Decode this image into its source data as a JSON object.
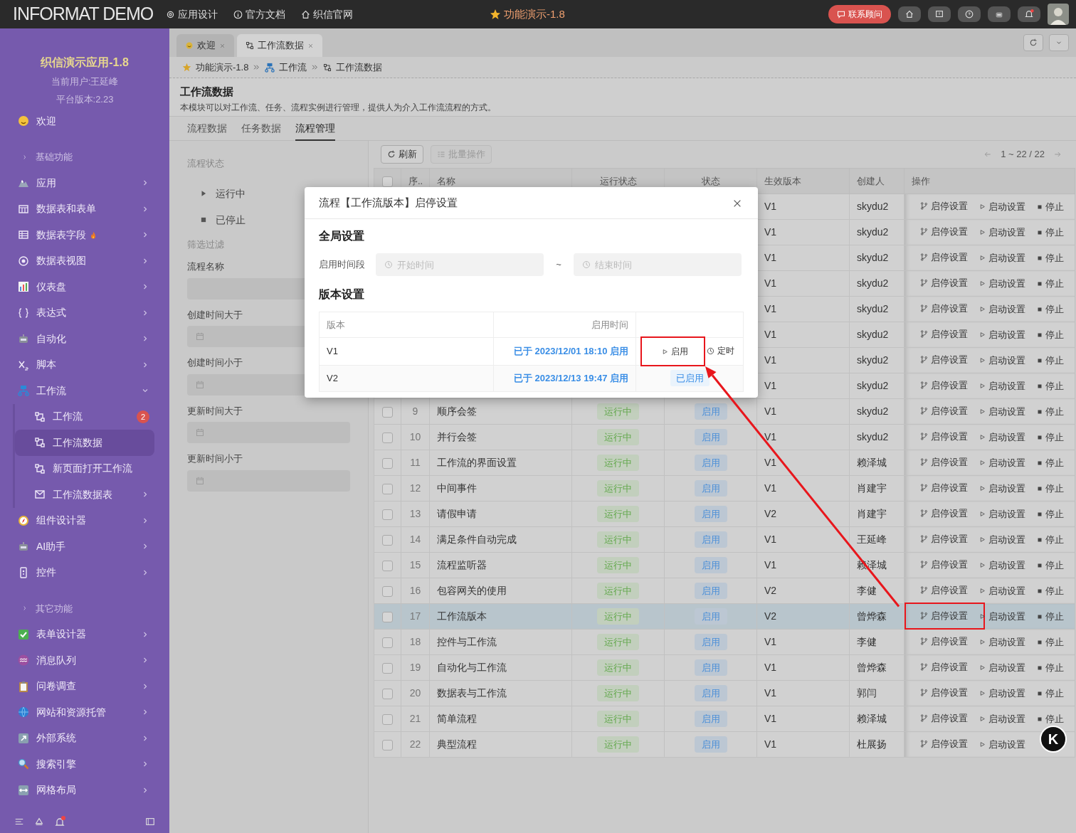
{
  "topbar": {
    "logo": "INFORMAT DEMO",
    "nav": [
      "应用设计",
      "官方文档",
      "织信官网"
    ],
    "title": "功能演示-1.8",
    "contact_button": "联系顾问"
  },
  "sidebar": {
    "app_name": "织信演示应用-1.8",
    "user": "当前用户:王延峰",
    "version": "平台版本:2.23",
    "items": [
      {
        "kind": "item",
        "label": "欢迎",
        "expandable": false,
        "selected": false
      },
      {
        "kind": "group",
        "label": "基础功能"
      },
      {
        "kind": "item",
        "label": "应用",
        "expandable": true,
        "expanded": false,
        "selected": false
      },
      {
        "kind": "item",
        "label": "数据表和表单",
        "expandable": true,
        "expanded": false,
        "selected": false
      },
      {
        "kind": "item",
        "label": "数据表字段",
        "expandable": true,
        "expanded": false,
        "selected": false
      },
      {
        "kind": "item",
        "label": "数据表视图",
        "expandable": true,
        "expanded": false,
        "selected": false
      },
      {
        "kind": "item",
        "label": "仪表盘",
        "expandable": true,
        "expanded": false,
        "selected": false
      },
      {
        "kind": "item",
        "label": "表达式",
        "expandable": true,
        "expanded": false,
        "selected": false
      },
      {
        "kind": "item",
        "label": "自动化",
        "expandable": true,
        "expanded": false,
        "selected": false
      },
      {
        "kind": "item",
        "label": "脚本",
        "expandable": true,
        "expanded": false,
        "selected": false
      },
      {
        "kind": "item",
        "label": "工作流",
        "expandable": true,
        "expanded": true,
        "selected": false,
        "children": [
          {
            "label": "工作流",
            "badge": "2",
            "expandable": false,
            "selected": false
          },
          {
            "label": "工作流数据",
            "expandable": false,
            "selected": true
          },
          {
            "label": "新页面打开工作流",
            "expandable": false,
            "selected": false
          },
          {
            "label": "工作流数据表",
            "expandable": true,
            "expanded": false,
            "selected": false
          }
        ]
      },
      {
        "kind": "item",
        "label": "组件设计器",
        "expandable": true,
        "expanded": false,
        "selected": false
      },
      {
        "kind": "item",
        "label": "AI助手",
        "expandable": true,
        "expanded": false,
        "selected": false
      },
      {
        "kind": "item",
        "label": "控件",
        "expandable": true,
        "expanded": false,
        "selected": false
      },
      {
        "kind": "group",
        "label": "其它功能"
      },
      {
        "kind": "item",
        "label": "表单设计器",
        "expandable": true,
        "expanded": false,
        "selected": false
      },
      {
        "kind": "item",
        "label": "消息队列",
        "expandable": true,
        "expanded": false,
        "selected": false
      },
      {
        "kind": "item",
        "label": "问卷调查",
        "expandable": true,
        "expanded": false,
        "selected": false
      },
      {
        "kind": "item",
        "label": "网站和资源托管",
        "expandable": true,
        "expanded": false,
        "selected": false
      },
      {
        "kind": "item",
        "label": "外部系统",
        "expandable": true,
        "expanded": false,
        "selected": false
      },
      {
        "kind": "item",
        "label": "搜索引擎",
        "expandable": true,
        "expanded": false,
        "selected": false
      },
      {
        "kind": "item",
        "label": "网格布局",
        "expandable": true,
        "expanded": false,
        "selected": false
      }
    ]
  },
  "tabs": [
    {
      "label": "欢迎",
      "selected": false
    },
    {
      "label": "工作流数据",
      "selected": true
    }
  ],
  "breadcrumb": [
    "功能演示-1.8",
    "工作流",
    "工作流数据"
  ],
  "page": {
    "title": "工作流数据",
    "description": "本模块可以对工作流、任务、流程实例进行管理，提供人为介入工作流流程的方式。"
  },
  "subtabs": [
    {
      "label": "流程数据",
      "selected": false
    },
    {
      "label": "任务数据",
      "selected": false
    },
    {
      "label": "流程管理",
      "selected": true
    }
  ],
  "filters": {
    "status_title": "流程状态",
    "statuses": [
      {
        "label": "运行中",
        "kind": "running"
      },
      {
        "label": "已停止",
        "kind": "stopped"
      }
    ],
    "filter_title": "筛选过滤",
    "fields": [
      {
        "label": "流程名称",
        "kind": "text"
      },
      {
        "label": "创建时间大于",
        "kind": "date"
      },
      {
        "label": "创建时间小于",
        "kind": "date"
      },
      {
        "label": "更新时间大于",
        "kind": "date"
      },
      {
        "label": "更新时间小于",
        "kind": "date"
      }
    ]
  },
  "toolbar": {
    "refresh": "刷新",
    "batch": "批量操作",
    "batch_disabled": true,
    "pagination": "1 ~ 22 / 22"
  },
  "table": {
    "all_checked": false,
    "columns": [
      "序..",
      "名称",
      "运行状态",
      "状态",
      "生效版本",
      "创建人",
      "操作"
    ],
    "rows": [
      {
        "version": "V1",
        "creator": "skydu2",
        "actions": [
          "启停设置",
          "启动设置",
          "停止"
        ],
        "selected": false,
        "highlighted": false
      },
      {
        "version": "V1",
        "creator": "skydu2",
        "actions": [
          "启停设置",
          "启动设置",
          "停止"
        ],
        "selected": false,
        "highlighted": false
      },
      {
        "version": "V1",
        "creator": "skydu2",
        "actions": [
          "启停设置",
          "启动设置",
          "停止"
        ],
        "selected": false,
        "highlighted": false
      },
      {
        "version": "V1",
        "creator": "skydu2",
        "actions": [
          "启停设置",
          "启动设置",
          "停止"
        ],
        "selected": false,
        "highlighted": false
      },
      {
        "version": "V1",
        "creator": "skydu2",
        "actions": [
          "启停设置",
          "启动设置",
          "停止"
        ],
        "selected": false,
        "highlighted": false
      },
      {
        "version": "V1",
        "creator": "skydu2",
        "actions": [
          "启停设置",
          "启动设置",
          "停止"
        ],
        "selected": false,
        "highlighted": false
      },
      {
        "version": "V1",
        "creator": "skydu2",
        "actions": [
          "启停设置",
          "启动设置",
          "停止"
        ],
        "selected": false,
        "highlighted": false
      },
      {
        "version": "V1",
        "creator": "skydu2",
        "actions": [
          "启停设置",
          "启动设置",
          "停止"
        ],
        "selected": false,
        "highlighted": false
      },
      {
        "index": "9",
        "name": "顺序会签",
        "run_status": "运行中",
        "status": "启用",
        "version": "V1",
        "creator": "skydu2",
        "actions": [
          "启停设置",
          "启动设置",
          "停止"
        ],
        "checked": false,
        "selected": false,
        "highlighted": false
      },
      {
        "index": "10",
        "name": "并行会签",
        "run_status": "运行中",
        "status": "启用",
        "version": "V1",
        "creator": "skydu2",
        "actions": [
          "启停设置",
          "启动设置",
          "停止"
        ],
        "checked": false,
        "selected": false,
        "highlighted": false
      },
      {
        "index": "11",
        "name": "工作流的界面设置",
        "run_status": "运行中",
        "status": "启用",
        "version": "V1",
        "creator": "赖泽城",
        "actions": [
          "启停设置",
          "启动设置",
          "停止"
        ],
        "checked": false,
        "selected": false,
        "highlighted": false
      },
      {
        "index": "12",
        "name": "中间事件",
        "run_status": "运行中",
        "status": "启用",
        "version": "V1",
        "creator": "肖建宇",
        "actions": [
          "启停设置",
          "启动设置",
          "停止"
        ],
        "checked": false,
        "selected": false,
        "highlighted": false
      },
      {
        "index": "13",
        "name": "请假申请",
        "run_status": "运行中",
        "status": "启用",
        "version": "V2",
        "creator": "肖建宇",
        "actions": [
          "启停设置",
          "启动设置",
          "停止"
        ],
        "checked": false,
        "selected": false,
        "highlighted": false
      },
      {
        "index": "14",
        "name": "满足条件自动完成",
        "run_status": "运行中",
        "status": "启用",
        "version": "V1",
        "creator": "王延峰",
        "actions": [
          "启停设置",
          "启动设置",
          "停止"
        ],
        "checked": false,
        "selected": false,
        "highlighted": false
      },
      {
        "index": "15",
        "name": "流程监听器",
        "run_status": "运行中",
        "status": "启用",
        "version": "V1",
        "creator": "赖泽城",
        "actions": [
          "启停设置",
          "启动设置",
          "停止"
        ],
        "checked": false,
        "selected": false,
        "highlighted": false
      },
      {
        "index": "16",
        "name": "包容网关的使用",
        "run_status": "运行中",
        "status": "启用",
        "version": "V2",
        "creator": "李健",
        "actions": [
          "启停设置",
          "启动设置",
          "停止"
        ],
        "checked": false,
        "selected": false,
        "highlighted": false
      },
      {
        "index": "17",
        "name": "工作流版本",
        "run_status": "运行中",
        "status": "启用",
        "version": "V2",
        "creator": "曾烨森",
        "actions": [
          "启停设置",
          "启动设置",
          "停止"
        ],
        "checked": false,
        "selected": true,
        "highlighted": true
      },
      {
        "index": "18",
        "name": "控件与工作流",
        "run_status": "运行中",
        "status": "启用",
        "version": "V1",
        "creator": "李健",
        "actions": [
          "启停设置",
          "启动设置",
          "停止"
        ],
        "checked": false,
        "selected": false,
        "highlighted": false
      },
      {
        "index": "19",
        "name": "自动化与工作流",
        "run_status": "运行中",
        "status": "启用",
        "version": "V1",
        "creator": "曾烨森",
        "actions": [
          "启停设置",
          "启动设置",
          "停止"
        ],
        "checked": false,
        "selected": false,
        "highlighted": false
      },
      {
        "index": "20",
        "name": "数据表与工作流",
        "run_status": "运行中",
        "status": "启用",
        "version": "V1",
        "creator": "郭闫",
        "actions": [
          "启停设置",
          "启动设置",
          "停止"
        ],
        "checked": false,
        "selected": false,
        "highlighted": false
      },
      {
        "index": "21",
        "name": "简单流程",
        "run_status": "运行中",
        "status": "启用",
        "version": "V1",
        "creator": "赖泽城",
        "actions": [
          "启停设置",
          "启动设置",
          "停止"
        ],
        "checked": false,
        "selected": false,
        "highlighted": false
      },
      {
        "index": "22",
        "name": "典型流程",
        "run_status": "运行中",
        "status": "启用",
        "version": "V1",
        "creator": "杜展扬",
        "actions": [
          "启停设置",
          "启动设置"
        ],
        "checked": false,
        "selected": false,
        "highlighted": false
      }
    ]
  },
  "modal": {
    "title": "流程【工作流版本】启停设置",
    "global_title": "全局设置",
    "period_label": "启用时间段",
    "start_placeholder": "开始时间",
    "separator": "~",
    "end_placeholder": "结束时间",
    "version_title": "版本设置",
    "columns": [
      "版本",
      "启用时间"
    ],
    "versions": [
      {
        "version": "V1",
        "enabled_time": "已于 2023/12/01 18:10 启用",
        "kind": "actions",
        "actions": [
          "启用",
          "定时"
        ],
        "highlighted": true
      },
      {
        "version": "V2",
        "enabled_time": "已于 2023/12/13 19:47 启用",
        "kind": "enabled",
        "tag": "已启用",
        "highlighted": false
      }
    ]
  },
  "assistant_button": "K"
}
